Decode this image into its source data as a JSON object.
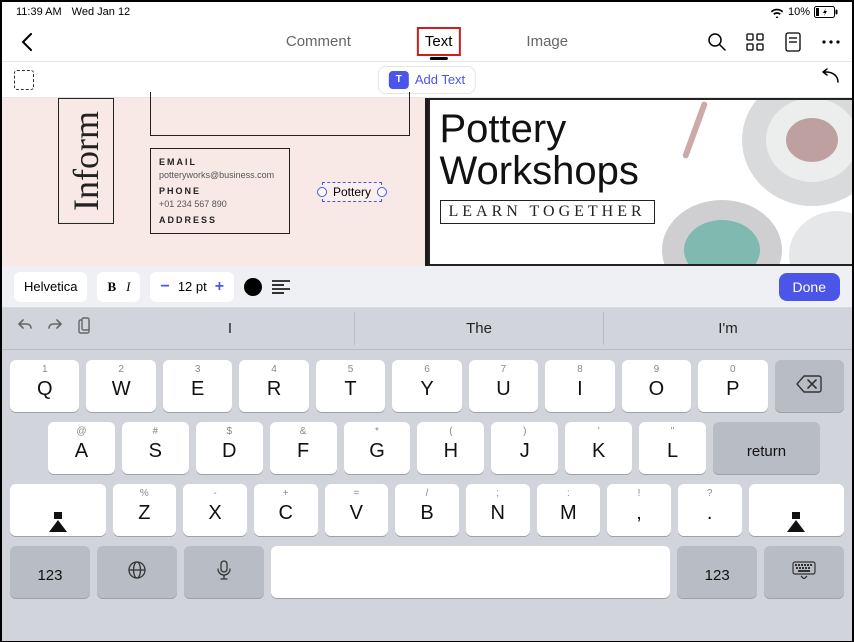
{
  "status": {
    "time": "11:39 AM",
    "date": "Wed Jan 12",
    "battery": "10%"
  },
  "toolbar": {
    "tabs": {
      "comment": "Comment",
      "text": "Text",
      "image": "Image"
    },
    "add_text": "Add Text"
  },
  "document": {
    "inform": "Inform",
    "contact": {
      "email_label": "EMAIL",
      "email": "potteryworks@business.com",
      "phone_label": "PHONE",
      "phone": "+01 234 567 890",
      "address_label": "ADDRESS"
    },
    "editing_text": "Pottery",
    "right_title_1": "Pottery",
    "right_title_2": "Workshops",
    "learn": "LEARN TOGETHER"
  },
  "format": {
    "font": "Helvetica",
    "bold": "B",
    "italic": "I",
    "minus": "−",
    "size": "12 pt",
    "plus": "+",
    "done": "Done"
  },
  "keyboard": {
    "suggestions": [
      "I",
      "The",
      "I'm"
    ],
    "row1": [
      {
        "alt": "1",
        "main": "Q"
      },
      {
        "alt": "2",
        "main": "W"
      },
      {
        "alt": "3",
        "main": "E"
      },
      {
        "alt": "4",
        "main": "R"
      },
      {
        "alt": "5",
        "main": "T"
      },
      {
        "alt": "6",
        "main": "Y"
      },
      {
        "alt": "7",
        "main": "U"
      },
      {
        "alt": "8",
        "main": "I"
      },
      {
        "alt": "9",
        "main": "O"
      },
      {
        "alt": "0",
        "main": "P"
      }
    ],
    "row2": [
      {
        "alt": "@",
        "main": "A"
      },
      {
        "alt": "#",
        "main": "S"
      },
      {
        "alt": "$",
        "main": "D"
      },
      {
        "alt": "&",
        "main": "F"
      },
      {
        "alt": "*",
        "main": "G"
      },
      {
        "alt": "(",
        "main": "H"
      },
      {
        "alt": ")",
        "main": "J"
      },
      {
        "alt": "'",
        "main": "K"
      },
      {
        "alt": "\"",
        "main": "L"
      }
    ],
    "row3": [
      {
        "alt": "%",
        "main": "Z"
      },
      {
        "alt": "-",
        "main": "X"
      },
      {
        "alt": "+",
        "main": "C"
      },
      {
        "alt": "=",
        "main": "V"
      },
      {
        "alt": "/",
        "main": "B"
      },
      {
        "alt": ";",
        "main": "N"
      },
      {
        "alt": ":",
        "main": "M"
      },
      {
        "alt": "!",
        "main": ","
      },
      {
        "alt": "?",
        "main": "."
      }
    ],
    "numkey": "123",
    "return": "return"
  }
}
